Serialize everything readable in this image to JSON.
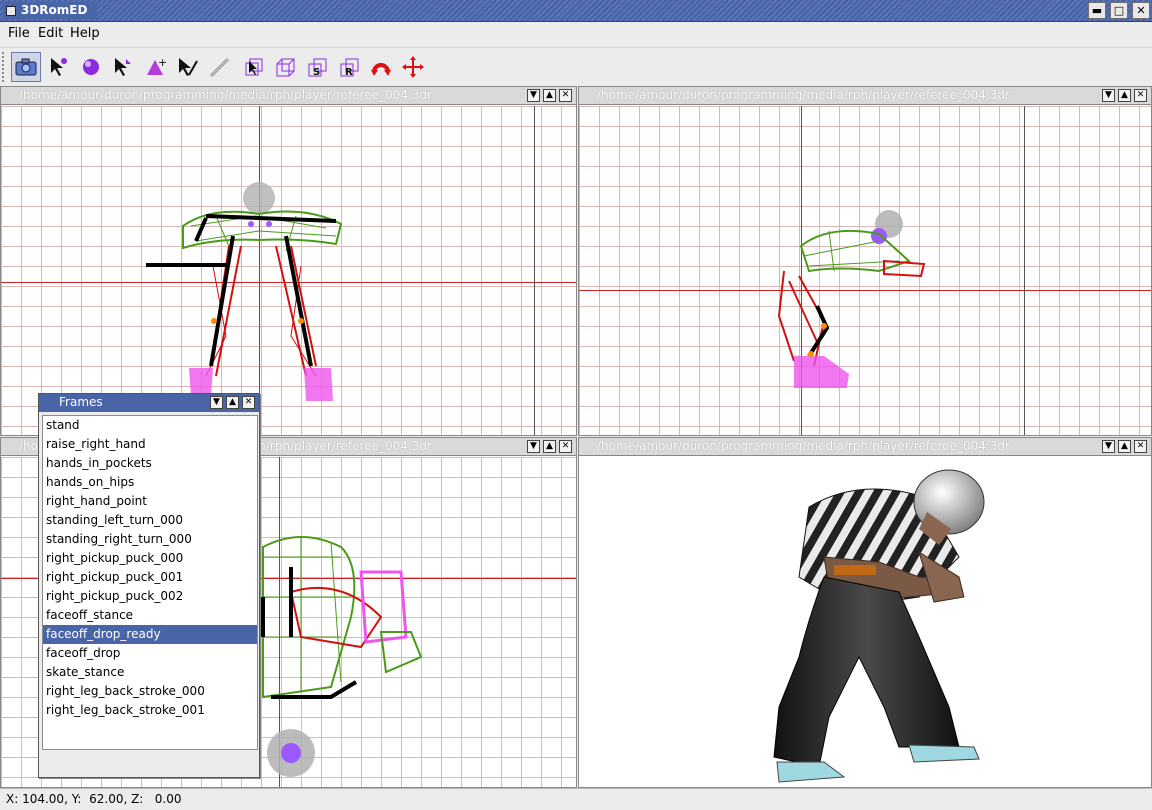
{
  "window": {
    "title": "3DRomED",
    "buttons": {
      "minimize": "▬",
      "maximize": "□",
      "close": "✕"
    }
  },
  "menu": {
    "items": [
      {
        "label": "File"
      },
      {
        "label": "Edit"
      },
      {
        "label": "Help"
      }
    ]
  },
  "toolbar": {
    "tools": [
      {
        "icon": "camera-icon",
        "active": true
      },
      {
        "icon": "select-vertex-icon"
      },
      {
        "icon": "sphere-icon"
      },
      {
        "icon": "select-arrow-icon"
      },
      {
        "icon": "add-triangle-icon"
      },
      {
        "icon": "pick-arrow-icon"
      },
      {
        "icon": "line-icon"
      },
      {
        "icon": "cube-select-icon"
      },
      {
        "icon": "cube-move-icon"
      },
      {
        "icon": "cube-scale-icon",
        "letter": "S"
      },
      {
        "icon": "cube-rotate-icon",
        "letter": "R"
      },
      {
        "icon": "rotate-arrow-icon"
      },
      {
        "icon": "move-cross-icon"
      }
    ]
  },
  "viewports": [
    {
      "path": "/home/amour/duron/programming/media/rph/player/referee_004.3dr"
    },
    {
      "path": "/home/amour/duron/programming/media/rph/player/referee_004.3dr"
    },
    {
      "path": "/home/amour/duron/programming/media/rph/player/referee_004.3dr"
    },
    {
      "path": "/home/amour/duron/programming/media/rph/player/referee_004.3dr"
    }
  ],
  "panel_buttons": {
    "menu": "▼",
    "maximize": "▲",
    "close": "✕"
  },
  "frames": {
    "title": "Frames",
    "items": [
      "stand",
      "raise_right_hand",
      "hands_in_pockets",
      "hands_on_hips",
      "right_hand_point",
      "standing_left_turn_000",
      "standing_right_turn_000",
      "right_pickup_puck_000",
      "right_pickup_puck_001",
      "right_pickup_puck_002",
      "faceoff_stance",
      "faceoff_drop_ready",
      "faceoff_drop",
      "skate_stance",
      "right_leg_back_stroke_000",
      "right_leg_back_stroke_001"
    ],
    "selected_index": 11
  },
  "status": {
    "text": "X: 104.00, Y:  62.00, Z:   0.00"
  }
}
